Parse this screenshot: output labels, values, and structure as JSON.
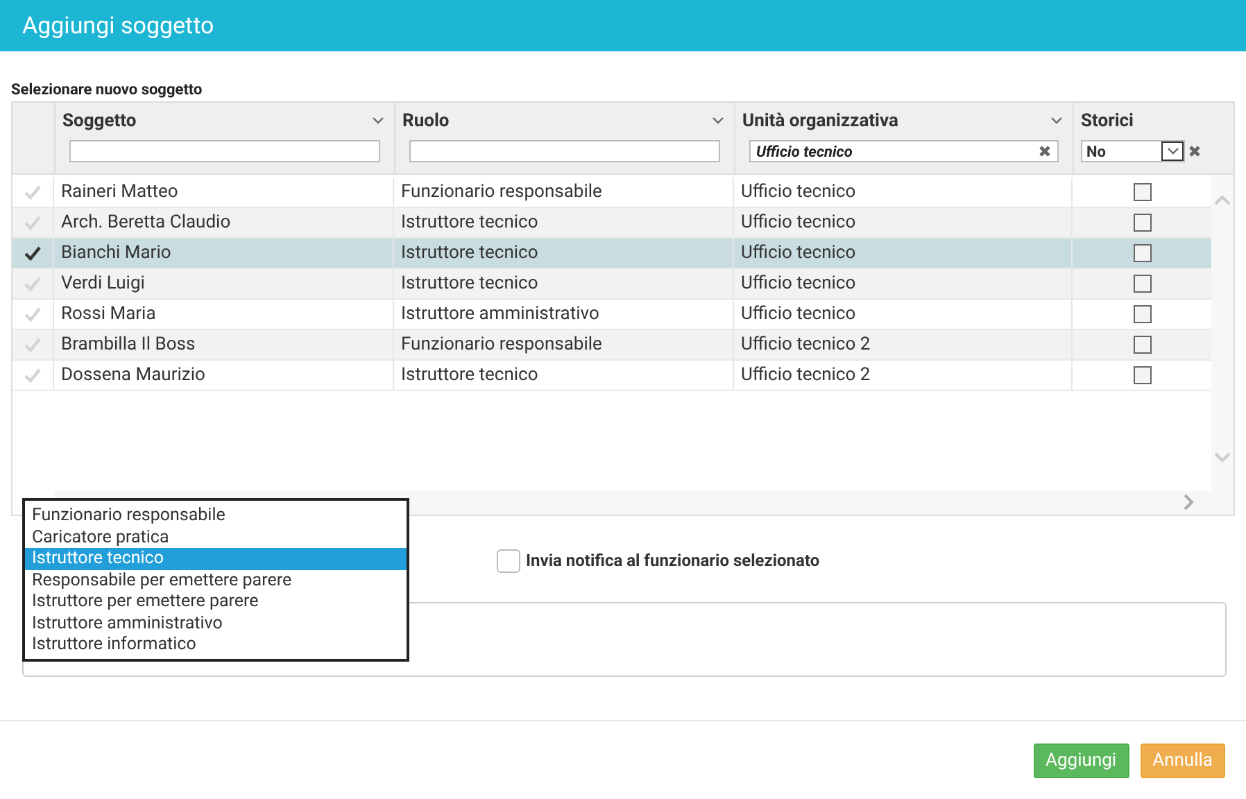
{
  "dialog": {
    "title": "Aggiungi soggetto"
  },
  "grid": {
    "caption": "Selezionare nuovo soggetto",
    "columns": [
      {
        "label": "Soggetto",
        "kind": "text",
        "menu": true
      },
      {
        "label": "Ruolo",
        "kind": "text",
        "menu": true
      },
      {
        "label": "Unità organizzativa",
        "kind": "text",
        "filter": "Ufficio tecnico",
        "menu": true
      },
      {
        "label": "Storici",
        "kind": "select",
        "filter": "No",
        "menu": false
      }
    ],
    "rows": [
      {
        "soggetto": "Raineri Matteo",
        "ruolo": "Funzionario responsabile",
        "unita": "Ufficio tecnico",
        "selected": false,
        "storici": false
      },
      {
        "soggetto": "Arch. Beretta Claudio",
        "ruolo": "Istruttore tecnico",
        "unita": "Ufficio tecnico",
        "selected": false,
        "storici": false
      },
      {
        "soggetto": "Bianchi Mario",
        "ruolo": "Istruttore tecnico",
        "unita": "Ufficio tecnico",
        "selected": true,
        "storici": false
      },
      {
        "soggetto": "Verdi Luigi",
        "ruolo": "Istruttore tecnico",
        "unita": "Ufficio tecnico",
        "selected": false,
        "storici": false
      },
      {
        "soggetto": "Rossi Maria",
        "ruolo": "Istruttore amministrativo",
        "unita": "Ufficio tecnico",
        "selected": false,
        "storici": false
      },
      {
        "soggetto": "Brambilla Il Boss",
        "ruolo": "Funzionario responsabile",
        "unita": "Ufficio tecnico 2",
        "selected": false,
        "storici": false
      },
      {
        "soggetto": "Dossena Maurizio",
        "ruolo": "Istruttore tecnico",
        "unita": "Ufficio tecnico 2",
        "selected": false,
        "storici": false
      }
    ]
  },
  "role_options": [
    {
      "label": "Funzionario responsabile",
      "selected": false
    },
    {
      "label": "Caricatore pratica",
      "selected": false
    },
    {
      "label": "Istruttore tecnico",
      "selected": true
    },
    {
      "label": "Responsabile per emettere parere",
      "selected": false
    },
    {
      "label": "Istruttore per emettere parere",
      "selected": false
    },
    {
      "label": "Istruttore amministrativo",
      "selected": false
    },
    {
      "label": "Istruttore informatico",
      "selected": false
    }
  ],
  "notify": {
    "label": "Invia notifica al funzionario selezionato",
    "checked": false
  },
  "buttons": [
    {
      "label": "Aggiungi",
      "kind": "primary"
    },
    {
      "label": "Annulla",
      "kind": "cancel"
    }
  ]
}
